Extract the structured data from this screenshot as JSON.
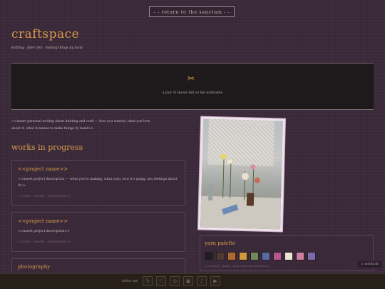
{
  "return_link": "- - return to the sanctum - -",
  "site": {
    "title": "craftspace",
    "tagline": "knitting · fiber arts · making things by hand"
  },
  "banner": {
    "left_dots": "· · ·",
    "right_dots": "· · ·",
    "caption": "a pair of shears fell on the worktable"
  },
  "intro": "<<insert personal writing about knitting and craft — how you started, what you love about it, what it means to make things by hand>>",
  "works": {
    "title": "works in progress",
    "projects": [
      {
        "name": "<<project name>>",
        "description": "<<insert project description — what you're making, what yarn, how it's going, any feelings about it>>",
        "meta": "<<yarn · needle · sizes/notes>>"
      },
      {
        "name": "<<project name>>",
        "description": "<<insert project description>>",
        "meta": "<<yarn · needle · sizes/notes>>"
      }
    ]
  },
  "photography": {
    "title": "photography"
  },
  "palette": {
    "title": "yarn palette",
    "swatches": [
      "#1f1f1f",
      "#4a3a30",
      "#b06a2c",
      "#d09a3b",
      "#6f8a5a",
      "#5a6aa5",
      "#b4588a",
      "#ede4d2",
      "#d07ea0",
      "#7a6ab0"
    ],
    "note": "<<swatch · name · your color description>>"
  },
  "scroll_chip": "⇩ scroll all",
  "footer": {
    "label": "follow me"
  }
}
